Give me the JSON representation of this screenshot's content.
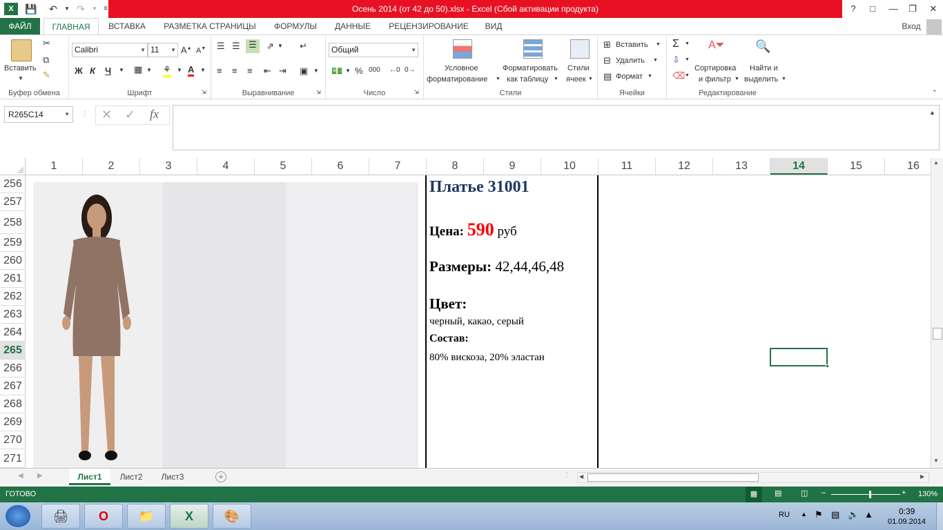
{
  "window": {
    "title": "Осень 2014 (от 42 до 50).xlsx -  Excel (Сбой активации продукта)",
    "help": "?",
    "signin": "Вход"
  },
  "tabs": [
    "ФАЙЛ",
    "ГЛАВНАЯ",
    "ВСТАВКА",
    "РАЗМЕТКА СТРАНИЦЫ",
    "ФОРМУЛЫ",
    "ДАННЫЕ",
    "РЕЦЕНЗИРОВАНИЕ",
    "ВИД"
  ],
  "ribbon": {
    "clipboard": {
      "paste": "Вставить",
      "label": "Буфер обмена"
    },
    "font": {
      "name": "Calibri",
      "size": "11",
      "bold": "Ж",
      "italic": "К",
      "underline": "Ч",
      "label": "Шрифт"
    },
    "alignment": {
      "label": "Выравнивание"
    },
    "number": {
      "format": "Общий",
      "percent": "%",
      "thousands": "000",
      "label": "Число"
    },
    "styles": {
      "conditional_1": "Условное",
      "conditional_2": "форматирование",
      "astable_1": "Форматировать",
      "astable_2": "как таблицу",
      "cellstyles_1": "Стили",
      "cellstyles_2": "ячеек",
      "label": "Стили"
    },
    "cells": {
      "insert": "Вставить",
      "delete": "Удалить",
      "format": "Формат",
      "label": "Ячейки"
    },
    "editing": {
      "sort_1": "Сортировка",
      "sort_2": "и фильтр",
      "find_1": "Найти и",
      "find_2": "выделить",
      "label": "Редактирование"
    }
  },
  "formula_bar": {
    "name_box": "R265C14",
    "fx": "fx",
    "content": ""
  },
  "columns": [
    "1",
    "2",
    "3",
    "4",
    "5",
    "6",
    "7",
    "8",
    "9",
    "10",
    "11",
    "12",
    "13",
    "14",
    "15",
    "16"
  ],
  "selected_column": "14",
  "rows": [
    "256",
    "257",
    "258",
    "259",
    "260",
    "261",
    "262",
    "263",
    "264",
    "265",
    "266",
    "267",
    "268",
    "269",
    "270",
    "271"
  ],
  "selected_row": "265",
  "product": {
    "title": "Платье 31001",
    "price_label": "Цена:",
    "price_value": "590",
    "price_unit": "руб",
    "sizes_label": "Размеры:",
    "sizes_value": "42,44,46,48",
    "color_label": "Цвет:",
    "color_value": "черный, какао, серый",
    "composition_label": "Состав:",
    "composition_value": "80% вискоза, 20% эластан",
    "dress_colors": [
      "#8f7466",
      "#7b7b7d",
      "#161616"
    ]
  },
  "sheets": [
    "Лист1",
    "Лист2",
    "Лист3"
  ],
  "active_sheet": "Лист1",
  "status": {
    "ready": "ГОТОВО",
    "zoom": "130%",
    "zoom_fraction": 0.55
  },
  "taskbar": {
    "lang": "RU",
    "time": "0:39",
    "date": "01.09.2014"
  }
}
